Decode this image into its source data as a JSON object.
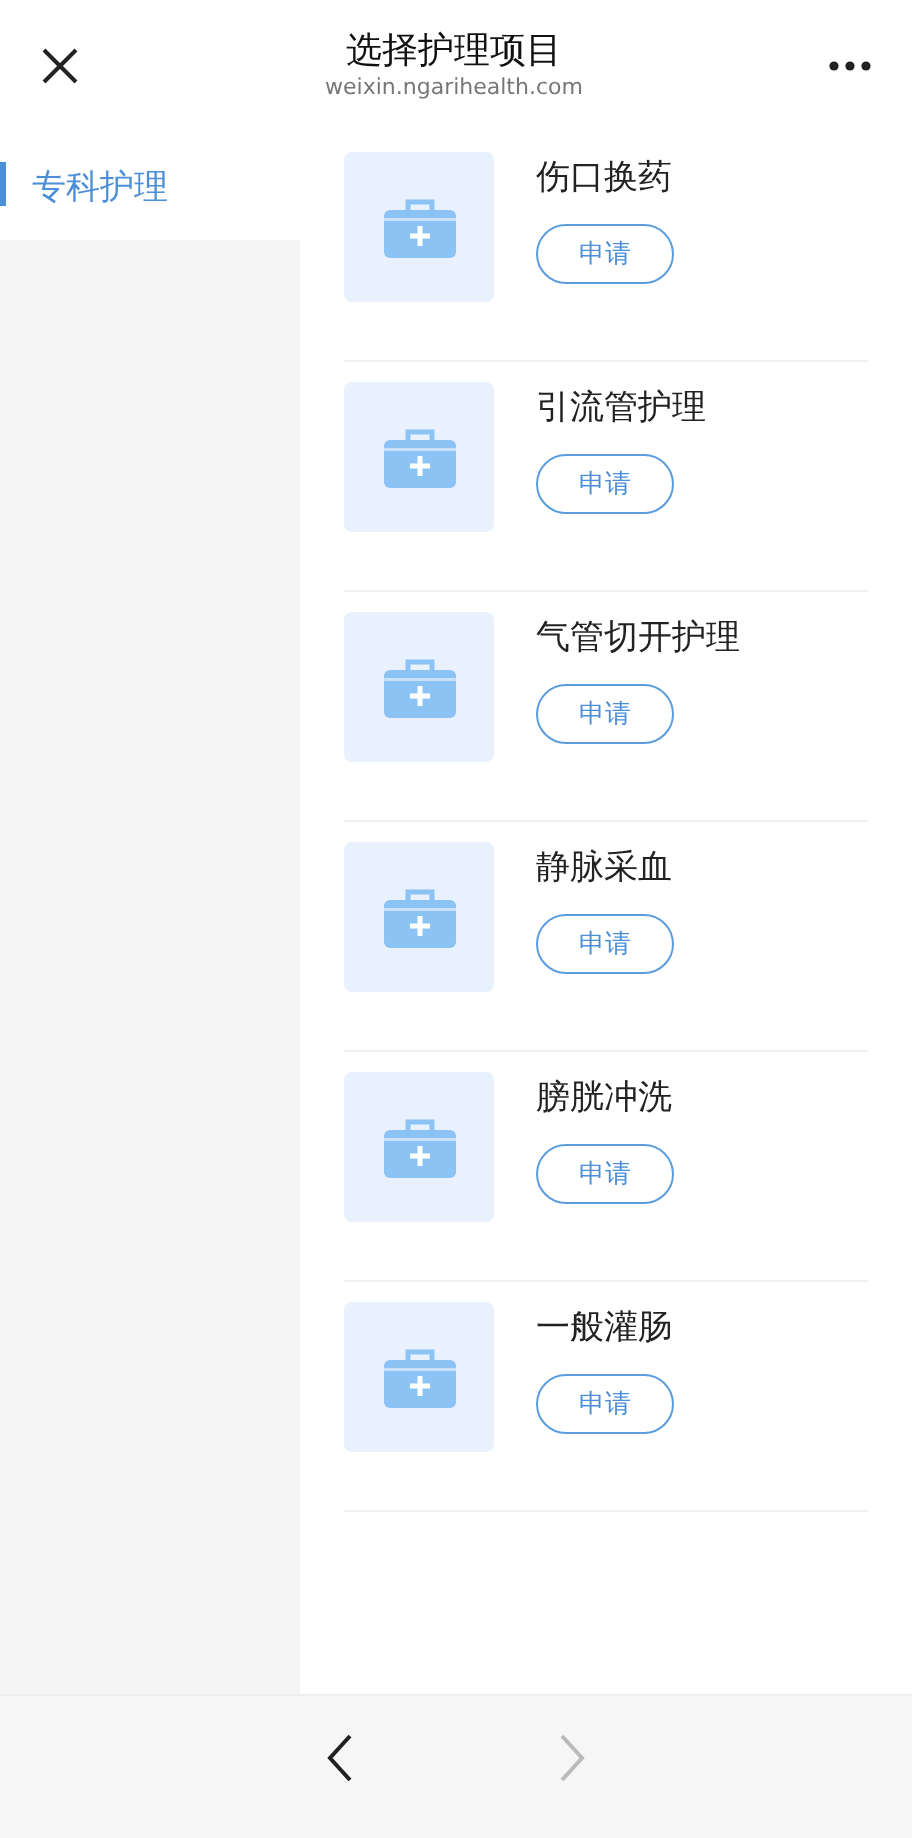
{
  "header": {
    "title": "选择护理项目",
    "subtitle": "weixin.ngarihealth.com"
  },
  "sidebar": {
    "items": [
      {
        "label": "专科护理",
        "selected": true
      }
    ]
  },
  "items": [
    {
      "name": "伤口换药",
      "button": "申请"
    },
    {
      "name": "引流管护理",
      "button": "申请"
    },
    {
      "name": "气管切开护理",
      "button": "申请"
    },
    {
      "name": "静脉采血",
      "button": "申请"
    },
    {
      "name": "膀胱冲洗",
      "button": "申请"
    },
    {
      "name": "一般灌肠",
      "button": "申请"
    }
  ],
  "nav": {
    "back_disabled": false,
    "forward_disabled": true
  }
}
